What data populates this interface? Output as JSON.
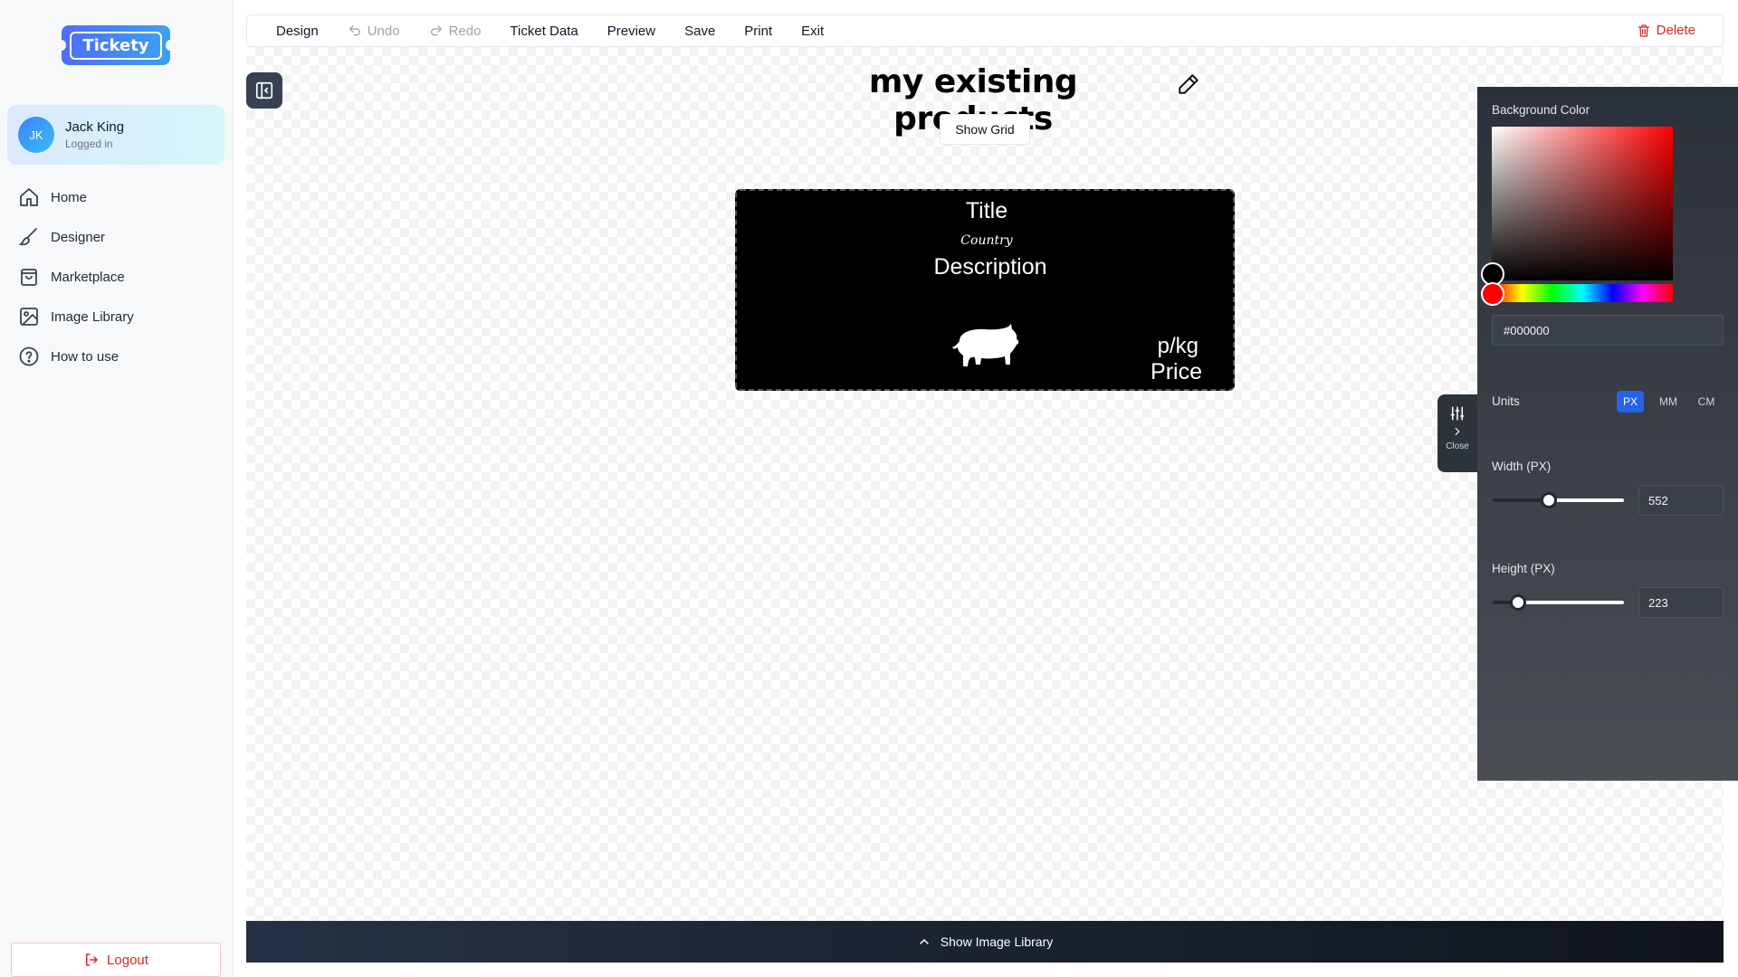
{
  "app": {
    "logo_text": "Tickety"
  },
  "user": {
    "initials": "JK",
    "name": "Jack King",
    "status": "Logged in"
  },
  "sidebar": {
    "items": [
      {
        "label": "Home",
        "icon": "home-icon"
      },
      {
        "label": "Designer",
        "icon": "brush-icon"
      },
      {
        "label": "Marketplace",
        "icon": "shopping-bag-icon"
      },
      {
        "label": "Image Library",
        "icon": "image-icon"
      },
      {
        "label": "How to use",
        "icon": "help-circle-icon"
      }
    ],
    "logout_label": "Logout"
  },
  "toolbar": {
    "design": "Design",
    "undo": "Undo",
    "redo": "Redo",
    "ticket_data": "Ticket Data",
    "preview": "Preview",
    "save": "Save",
    "print": "Print",
    "exit": "Exit",
    "delete": "Delete"
  },
  "document": {
    "title": "my existing products",
    "show_grid_label": "Show Grid"
  },
  "ticket": {
    "title": "Title",
    "country": "Country",
    "description": "Description",
    "unit": "p/kg",
    "price": "Price",
    "image": "pig-silhouette-icon",
    "background": "#000000"
  },
  "properties": {
    "toggle_label": "Close",
    "background_color_label": "Background Color",
    "background_color_value": "#000000",
    "units_label": "Units",
    "units": [
      "PX",
      "MM",
      "CM"
    ],
    "active_unit": "PX",
    "width_label": "Width (PX)",
    "width_value": "552",
    "width_fraction": 0.43,
    "height_label": "Height (PX)",
    "height_value": "223",
    "height_fraction": 0.2
  },
  "bottom_bar": {
    "label": "Show Image Library"
  },
  "colors": {
    "accent": "#2563eb",
    "danger": "#dc2626",
    "panel": "#2b313b"
  }
}
